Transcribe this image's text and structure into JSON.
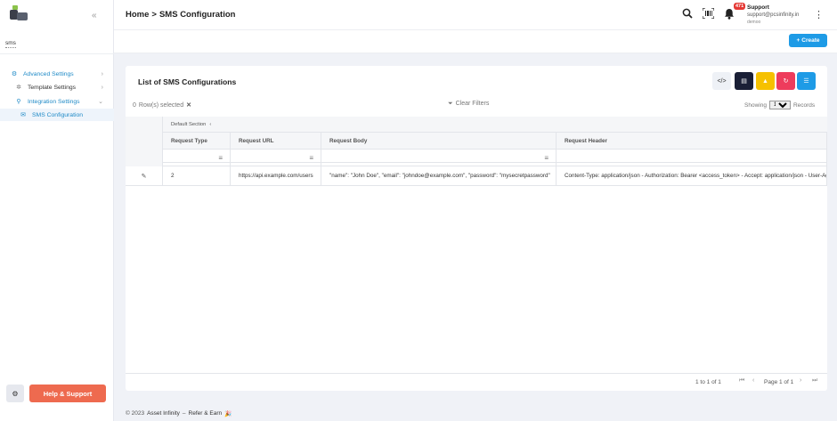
{
  "sidebar": {
    "module": "sms",
    "nav": [
      {
        "label": "Advanced Settings",
        "icon": "cogs-icon"
      },
      {
        "label": "Template Settings",
        "icon": "gear-icon"
      },
      {
        "label": "Integration Settings",
        "icon": "link-icon"
      },
      {
        "label": "SMS Configuration",
        "icon": "envelope-icon"
      }
    ],
    "help_label": "Help & Support"
  },
  "header": {
    "breadcrumb_home": "Home",
    "breadcrumb_sep": ">",
    "breadcrumb_current": "SMS Configuration",
    "notification_count": "471",
    "user_name": "Support",
    "user_email": "support@pcsinfinity.in",
    "user_org": "demoo"
  },
  "toolbar": {
    "create_label": "Create",
    "create_icon": "+"
  },
  "list": {
    "title": "List of SMS Configurations",
    "rows_selected_count": "0",
    "rows_selected_label": "Row(s) selected",
    "clear_filters": "Clear Filters",
    "showing_label": "Showing",
    "page_size": "100",
    "records_label": "Records",
    "section_label": "Default Section",
    "tool_buttons": [
      {
        "name": "code-view",
        "color": "#eef1f6"
      },
      {
        "name": "document",
        "color": "#1a1f36"
      },
      {
        "name": "warning",
        "color": "#f6c100"
      },
      {
        "name": "refresh",
        "color": "#ee3c5c"
      },
      {
        "name": "list",
        "color": "#1e9be6"
      }
    ]
  },
  "table": {
    "columns": [
      "Request Type",
      "Request URL",
      "Request Body",
      "Request Header"
    ],
    "rows": [
      {
        "type": "2",
        "url": "https://api.example.com/users",
        "body": "\"name\": \"John Doe\", \"email\": \"johndoe@example.com\", \"password\": \"mysecretpassword\"",
        "header": "Content-Type: application/json - Authorization: Bearer <access_token> - Accept: application/json - User-Agent: MyApp/1.0"
      }
    ]
  },
  "pagination": {
    "count": "1 to 1 of 1",
    "page": "Page 1 of 1"
  },
  "footer": {
    "copyright": "© 2023",
    "brand": "Asset Infinity",
    "separator": "–",
    "refer": "Refer & Earn"
  }
}
